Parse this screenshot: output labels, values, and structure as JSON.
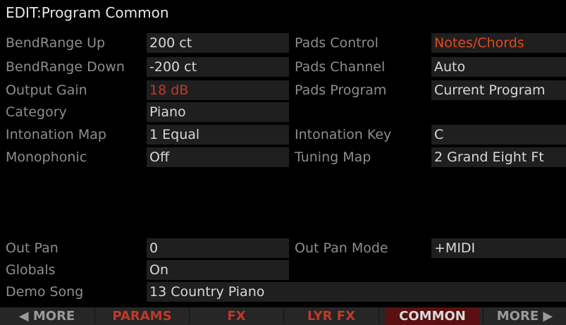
{
  "title": "EDIT:Program Common",
  "rows": {
    "bend_up": {
      "label": "BendRange Up",
      "value": "200 ct"
    },
    "bend_down": {
      "label": "BendRange Down",
      "value": "-200 ct"
    },
    "output_gain": {
      "label": "Output Gain",
      "value": "18 dB"
    },
    "category": {
      "label": "Category",
      "value": "Piano"
    },
    "intonation_map": {
      "label": "Intonation Map",
      "value": "1 Equal"
    },
    "monophonic": {
      "label": "Monophonic",
      "value": "Off"
    },
    "out_pan": {
      "label": "Out Pan",
      "value": "0"
    },
    "globals": {
      "label": "Globals",
      "value": "On"
    },
    "demo_song": {
      "label": "Demo Song",
      "value": "13 Country Piano"
    },
    "pads_control": {
      "label": "Pads Control",
      "value": "Notes/Chords"
    },
    "pads_channel": {
      "label": "Pads Channel",
      "value": "Auto"
    },
    "pads_program": {
      "label": "Pads Program",
      "value": "Current Program"
    },
    "intonation_key": {
      "label": "Intonation Key",
      "value": "C"
    },
    "tuning_map": {
      "label": "Tuning Map",
      "value": "2 Grand Eight Ft"
    },
    "out_pan_mode": {
      "label": "Out Pan Mode",
      "value": "+MIDI"
    }
  },
  "softkeys": {
    "more_left": "◀ MORE",
    "params": "PARAMS",
    "fx": "FX",
    "lyr_fx": "LYR FX",
    "common": "COMMON",
    "more_right": "MORE ▶"
  },
  "colors": {
    "accent": "#c0392b",
    "active_tab": "#5a1010",
    "value_bg": "#1f1f1f"
  }
}
